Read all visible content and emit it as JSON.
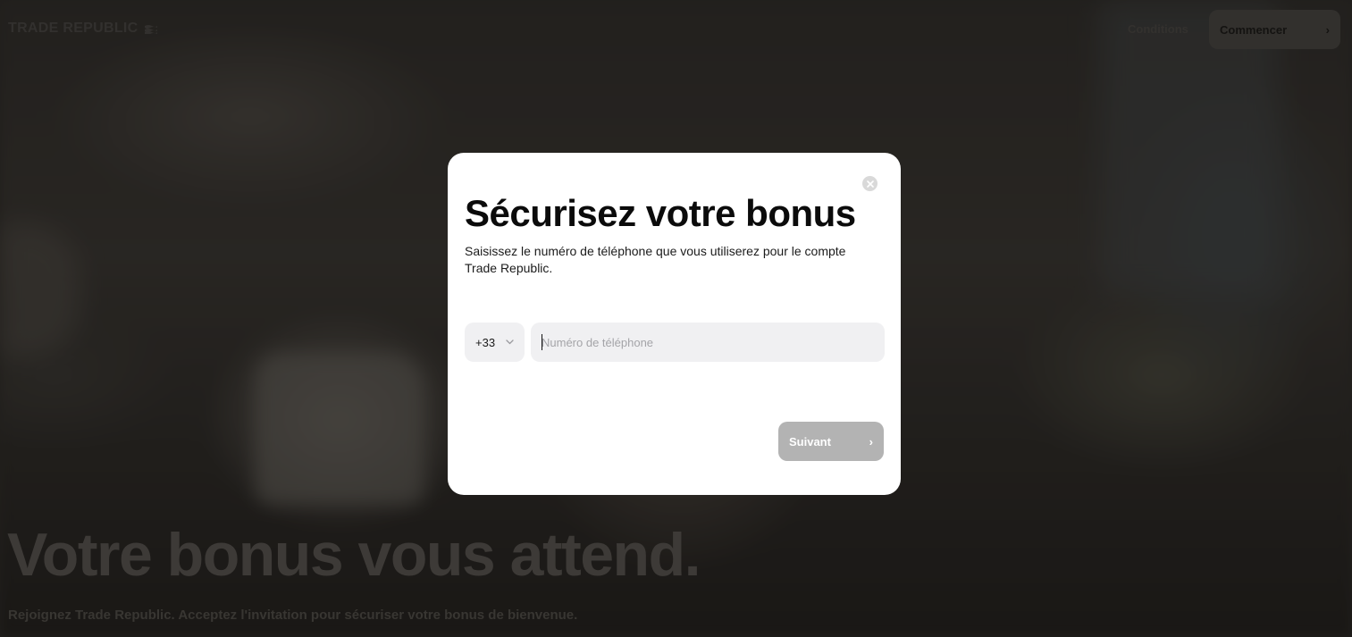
{
  "header": {
    "logo_text": "TRADE REPUBLIC",
    "conditions_link": "Conditions",
    "start_button": "Commencer",
    "start_button_icon": "chevron-right-icon"
  },
  "hero": {
    "title": "Votre bonus vous attend.",
    "subtitle": "Rejoignez Trade Republic. Acceptez l'invitation pour sécuriser votre bonus de bienvenue."
  },
  "modal": {
    "title": "Sécurisez votre bonus",
    "description": "Saisissez le numéro de téléphone que vous utiliserez pour le compte Trade Republic.",
    "country_code": "+33",
    "phone_value": "",
    "phone_placeholder": "Numéro de téléphone",
    "next_button": "Suivant",
    "close_icon": "close-icon"
  },
  "colors": {
    "modal_bg": "#ffffff",
    "input_bg": "#f0f0f2",
    "next_button_disabled": "#b3b3b3",
    "overlay": "#141210"
  }
}
